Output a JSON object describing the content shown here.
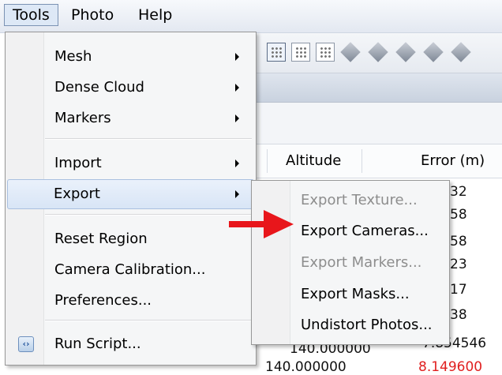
{
  "menubar": {
    "items": [
      {
        "label": "Tools",
        "active": true
      },
      {
        "label": "Photo",
        "active": false
      },
      {
        "label": "Help",
        "active": false
      }
    ]
  },
  "table": {
    "headers": [
      "Altitude",
      "Error (m)"
    ],
    "partial_values": [
      "32",
      "58",
      "58",
      "23",
      "17",
      "38",
      "140.000000",
      "7.854546",
      "140.000000",
      "8.149600"
    ],
    "error_color": "#e02020"
  },
  "tools_menu": {
    "items": [
      {
        "label": "Mesh",
        "submenu": true
      },
      {
        "label": "Dense Cloud",
        "submenu": true
      },
      {
        "label": "Markers",
        "submenu": true
      },
      {
        "label": "Import",
        "submenu": true
      },
      {
        "label": "Export",
        "submenu": true,
        "highlighted": true
      },
      {
        "label": "Reset Region",
        "submenu": false
      },
      {
        "label": "Camera Calibration...",
        "submenu": false
      },
      {
        "label": "Preferences...",
        "submenu": false
      },
      {
        "label": "Run Script...",
        "submenu": false,
        "icon": "script-icon"
      }
    ]
  },
  "export_submenu": {
    "items": [
      {
        "label": "Export Texture...",
        "enabled": false
      },
      {
        "label": "Export Cameras...",
        "enabled": true
      },
      {
        "label": "Export Markers...",
        "enabled": false
      },
      {
        "label": "Export Masks...",
        "enabled": true
      },
      {
        "label": "Undistort Photos...",
        "enabled": true
      }
    ]
  },
  "annotation": {
    "color": "#e8161b",
    "icon": "red-arrow-icon"
  }
}
